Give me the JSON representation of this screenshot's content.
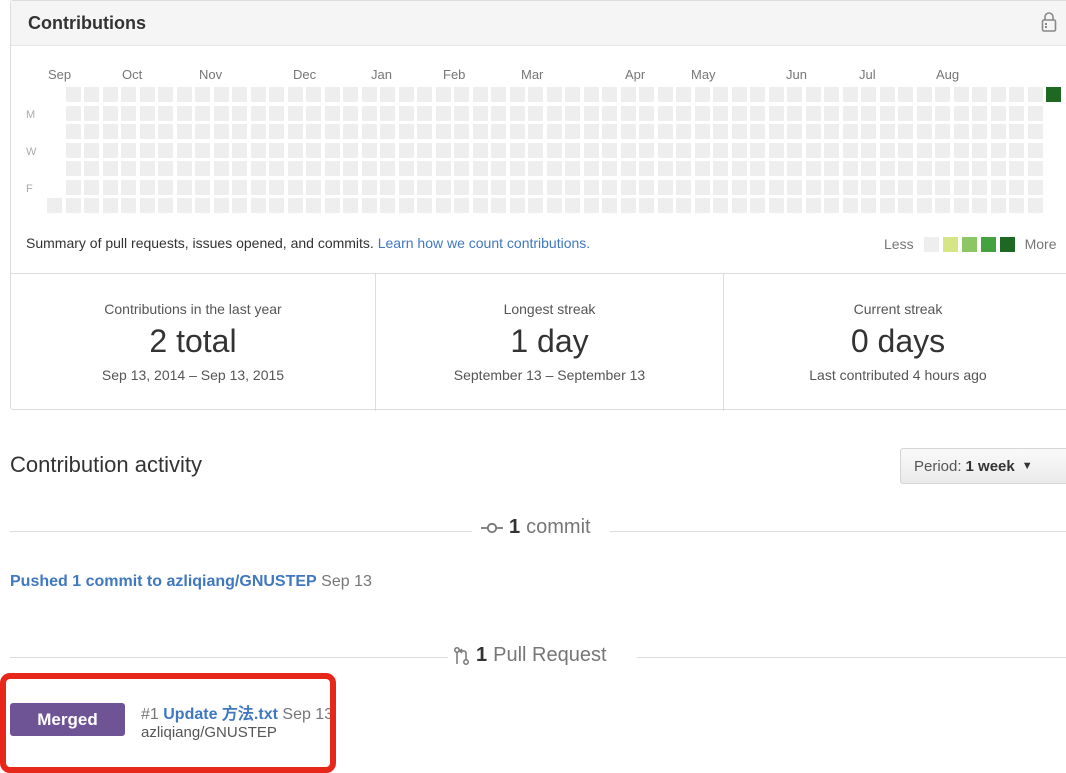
{
  "contributions": {
    "title": "Contributions",
    "lock_icon": "lock-icon",
    "months": [
      "Sep",
      "Oct",
      "Nov",
      "Dec",
      "Jan",
      "Feb",
      "Mar",
      "Apr",
      "May",
      "Jun",
      "Jul",
      "Aug"
    ],
    "weekdays": [
      "M",
      "W",
      "F"
    ],
    "summary_text": "Summary of pull requests, issues opened, and commits.",
    "summary_link": "Learn how we count contributions.",
    "legend_less": "Less",
    "legend_more": "More",
    "colors": {
      "empty": "#eeeeee",
      "level1": "#d6e685",
      "level2": "#8cc665",
      "level3": "#44a340",
      "level4": "#1e6823"
    },
    "active_day": "Sep 13, 2015"
  },
  "stats": [
    {
      "label": "Contributions in the last year",
      "value": "2 total",
      "sub": "Sep 13, 2014 – Sep 13, 2015"
    },
    {
      "label": "Longest streak",
      "value": "1 day",
      "sub": "September 13 – September 13"
    },
    {
      "label": "Current streak",
      "value": "0 days",
      "sub": "Last contributed 4 hours ago"
    }
  ],
  "activity": {
    "title": "Contribution activity",
    "period_label": "Period:",
    "period_value": "1 week",
    "commit_count": "1",
    "commit_text": "commit",
    "push_link": "Pushed 1 commit to azliqiang/GNUSTEP",
    "push_date": "Sep 13",
    "pr_count": "1",
    "pr_text": "Pull Request",
    "pr": {
      "badge": "Merged",
      "badge_color": "#6e5494",
      "number": "#1",
      "title": "Update 方法.txt",
      "date": "Sep 13",
      "repo": "azliqiang/GNUSTEP"
    }
  }
}
